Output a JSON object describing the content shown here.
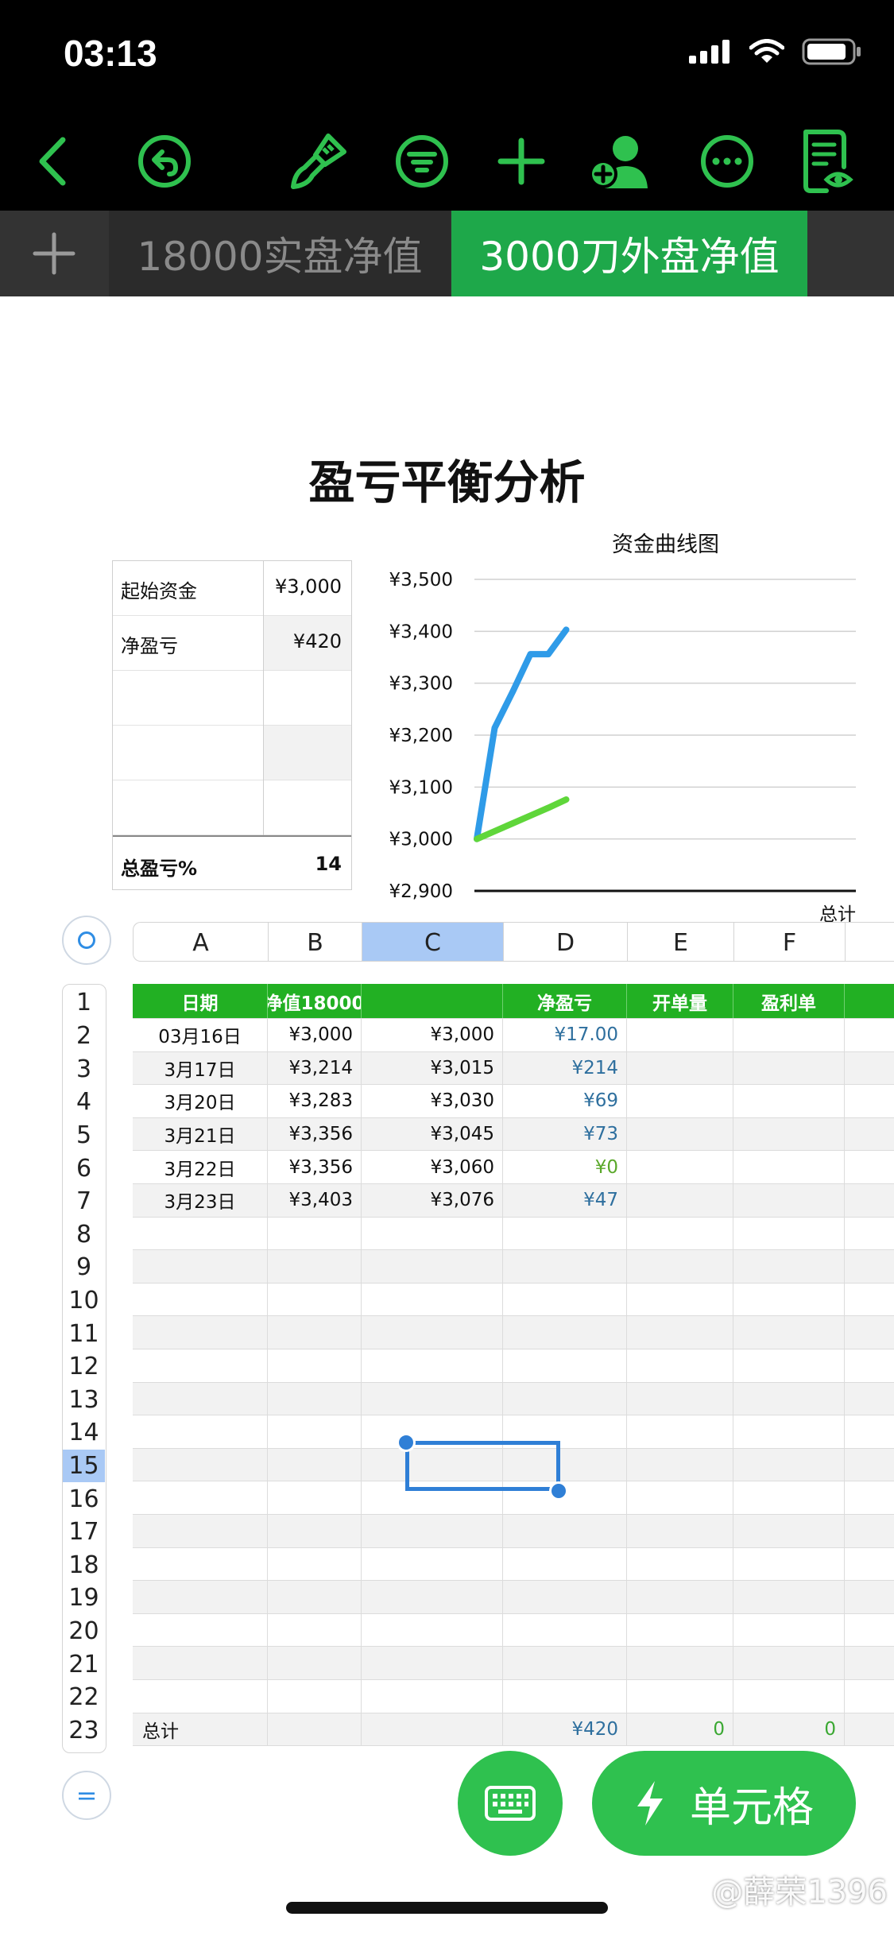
{
  "status_bar": {
    "time": "03:13"
  },
  "colors": {
    "accent": "#2fc14f",
    "header_green": "#22b023",
    "blue_line": "#2f9be8",
    "green_line": "#5fd63a",
    "selection": "#2f7fd6"
  },
  "toolbar": {
    "icons": [
      "back-icon",
      "undo-icon",
      "format-brush-icon",
      "filter-icon",
      "add-icon",
      "collaborate-icon",
      "more-icon",
      "reader-view-icon"
    ]
  },
  "tabs": [
    {
      "label": "18000实盘净值",
      "active": false
    },
    {
      "label": "3000刀外盘净值",
      "active": true
    }
  ],
  "page": {
    "title": "盈亏平衡分析"
  },
  "summary": {
    "rows": [
      {
        "label": "起始资金",
        "value": "¥3,000"
      },
      {
        "label": "净盈亏",
        "value": "¥420"
      }
    ],
    "total": {
      "label": "总盈亏%",
      "value": "14"
    }
  },
  "chart_data": {
    "type": "line",
    "title": "资金曲线图",
    "categories": [
      "03月16日",
      "3月17日",
      "3月20日",
      "3月21日",
      "3月22日",
      "3月23日"
    ],
    "series": [
      {
        "name": "净值18000",
        "values": [
          3000,
          3214,
          3283,
          3356,
          3356,
          3403
        ]
      },
      {
        "name": "",
        "values": [
          3000,
          3015,
          3030,
          3045,
          3060,
          3076
        ]
      }
    ],
    "y_ticks": [
      "¥3,500",
      "¥3,400",
      "¥3,300",
      "¥3,200",
      "¥3,100",
      "¥3,000",
      "¥2,900"
    ],
    "ylim": [
      2900,
      3500
    ],
    "x_axis_label": "总计",
    "grid": true
  },
  "sheet": {
    "columns": [
      "A",
      "B",
      "C",
      "D",
      "E",
      "F"
    ],
    "selected_column": "C",
    "selected_row": "15",
    "row_numbers": [
      "1",
      "2",
      "3",
      "4",
      "5",
      "6",
      "7",
      "8",
      "9",
      "10",
      "11",
      "12",
      "13",
      "14",
      "15",
      "16",
      "17",
      "18",
      "19",
      "20",
      "21",
      "22",
      "23"
    ],
    "header": [
      "日期",
      "净值18000",
      "",
      "净盈亏",
      "开单量",
      "盈利单"
    ],
    "rows": [
      [
        "03月16日",
        "¥3,000",
        "¥3,000",
        "¥17.00",
        "",
        ""
      ],
      [
        "3月17日",
        "¥3,214",
        "¥3,015",
        "¥214",
        "",
        ""
      ],
      [
        "3月20日",
        "¥3,283",
        "¥3,030",
        "¥69",
        "",
        ""
      ],
      [
        "3月21日",
        "¥3,356",
        "¥3,045",
        "¥73",
        "",
        ""
      ],
      [
        "3月22日",
        "¥3,356",
        "¥3,060",
        "¥0",
        "",
        ""
      ],
      [
        "3月23日",
        "¥3,403",
        "¥3,076",
        "¥47",
        "",
        ""
      ]
    ],
    "total_row": [
      "总计",
      "",
      "",
      "¥420",
      "0",
      "0"
    ]
  },
  "fab": {
    "cell_label": "单元格"
  },
  "watermark": "@薛荣1396"
}
